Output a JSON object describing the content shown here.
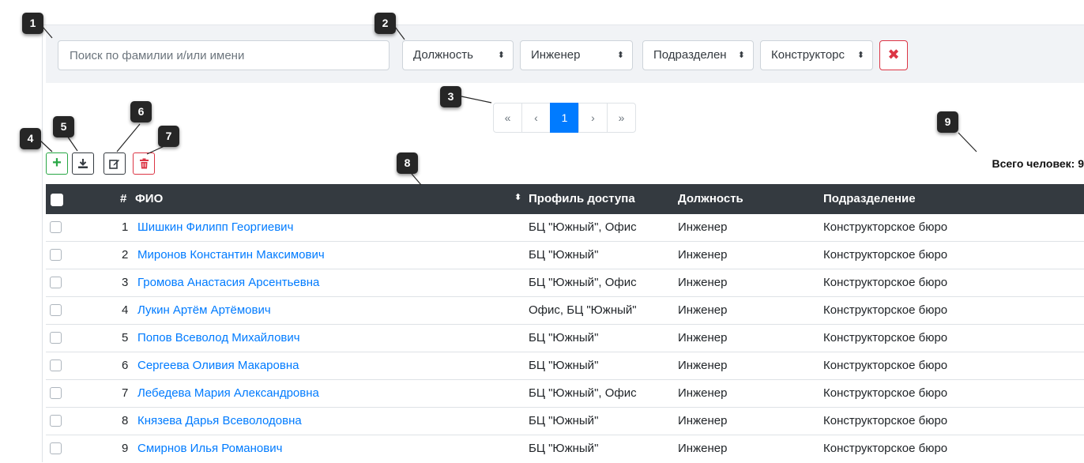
{
  "filters": {
    "search_placeholder": "Поиск по фамилии и/или имени",
    "position_label": "Должность",
    "position_value": "Инженер",
    "department_label": "Подразделен",
    "department_value": "Конструкторс",
    "select_arrow": "⬍",
    "clear_glyph": "✖"
  },
  "pagination": {
    "first": "«",
    "prev": "‹",
    "current": "1",
    "next": "›",
    "last": "»"
  },
  "toolbar": {
    "add_icon": "plus-icon",
    "download_icon": "download-icon",
    "edit_icon": "edit-icon",
    "delete_icon": "trash-icon"
  },
  "summary": {
    "total": "Всего человек: 9"
  },
  "table": {
    "headers": {
      "num": "#",
      "fio": "ФИО",
      "sort": "⬍",
      "profile": "Профиль доступа",
      "position": "Должность",
      "department": "Подразделение"
    },
    "rows": [
      {
        "num": "1",
        "fio": "Шишкин Филипп Георгиевич",
        "profile": "БЦ \"Южный\", Офис",
        "position": "Инженер",
        "department": "Конструкторское бюро"
      },
      {
        "num": "2",
        "fio": "Миронов Константин Максимович",
        "profile": "БЦ \"Южный\"",
        "position": "Инженер",
        "department": "Конструкторское бюро"
      },
      {
        "num": "3",
        "fio": "Громова Анастасия Арсентьевна",
        "profile": "БЦ \"Южный\", Офис",
        "position": "Инженер",
        "department": "Конструкторское бюро"
      },
      {
        "num": "4",
        "fio": "Лукин Артём Артёмович",
        "profile": "Офис, БЦ \"Южный\"",
        "position": "Инженер",
        "department": "Конструкторское бюро"
      },
      {
        "num": "5",
        "fio": "Попов Всеволод Михайлович",
        "profile": "БЦ \"Южный\"",
        "position": "Инженер",
        "department": "Конструкторское бюро"
      },
      {
        "num": "6",
        "fio": "Сергеева Оливия Макаровна",
        "profile": "БЦ \"Южный\"",
        "position": "Инженер",
        "department": "Конструкторское бюро"
      },
      {
        "num": "7",
        "fio": "Лебедева Мария Александровна",
        "profile": "БЦ \"Южный\", Офис",
        "position": "Инженер",
        "department": "Конструкторское бюро"
      },
      {
        "num": "8",
        "fio": "Князева Дарья Всеволодовна",
        "profile": "БЦ \"Южный\"",
        "position": "Инженер",
        "department": "Конструкторское бюро"
      },
      {
        "num": "9",
        "fio": "Смирнов Илья Романович",
        "profile": "БЦ \"Южный\"",
        "position": "Инженер",
        "department": "Конструкторское бюро"
      }
    ]
  },
  "callouts": {
    "c1": "1",
    "c2": "2",
    "c3": "3",
    "c4": "4",
    "c5": "5",
    "c6": "6",
    "c7": "7",
    "c8": "8",
    "c9": "9"
  },
  "colors": {
    "accent": "#007bff",
    "header_bg": "#343a40",
    "danger": "#dc3545",
    "success": "#28a745",
    "filter_bg": "#f1f3f6"
  }
}
